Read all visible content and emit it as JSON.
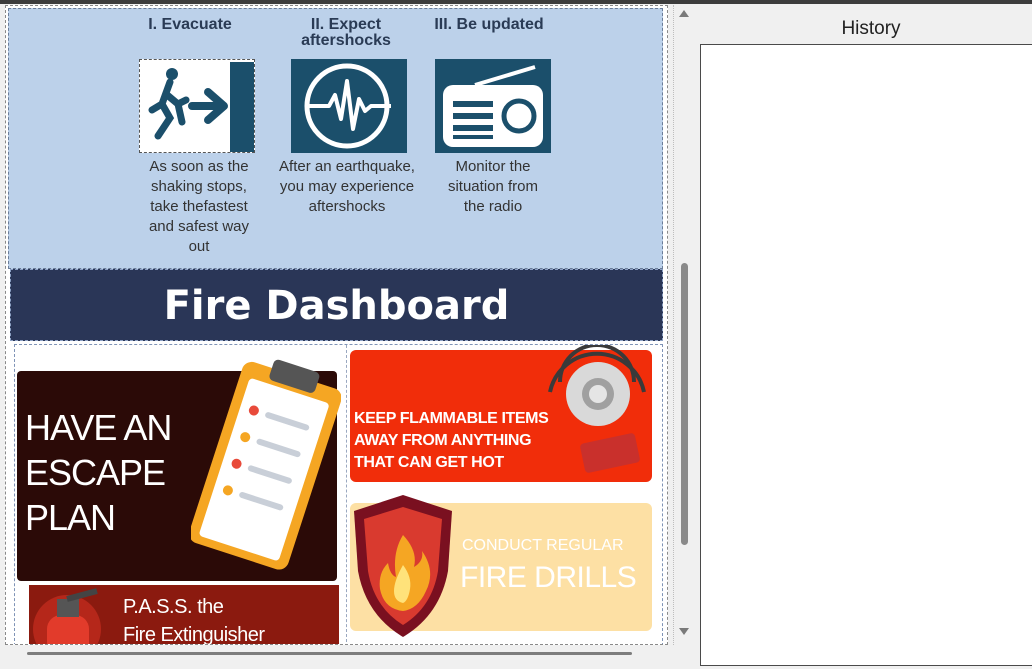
{
  "earthquake": {
    "steps": [
      {
        "title": "I. Evacuate",
        "icon": "exit-sign-icon",
        "text": [
          "As soon as the",
          "shaking stops,",
          "take thefastest",
          "and safest way",
          "out"
        ]
      },
      {
        "title_line1": "II. Expect",
        "title_line2": "aftershocks",
        "icon": "seismograph-icon",
        "text": [
          "After an earthquake,",
          "you may experience",
          "aftershocks"
        ]
      },
      {
        "title": "III. Be updated",
        "icon": "radio-icon",
        "text": [
          "Monitor the",
          "situation from",
          "the radio"
        ]
      }
    ],
    "colors": {
      "background": "#bcd1ea",
      "icon_bg": "#1b4f6b"
    }
  },
  "fire": {
    "header": "Fire Dashboard",
    "escape_plan": {
      "lines": [
        "HAVE AN",
        "ESCAPE",
        "PLAN"
      ],
      "icon": "clipboard-checklist-icon"
    },
    "pass": {
      "line1": "P.A.S.S. the",
      "line2": "Fire Extinguisher",
      "icon": "fire-extinguisher-icon"
    },
    "flammable": {
      "lines": [
        "KEEP FLAMMABLE ITEMS",
        "AWAY FROM ANYTHING",
        "THAT CAN GET HOT"
      ],
      "icon": "fire-alarm-bell-icon"
    },
    "drills": {
      "small": "CONDUCT REGULAR",
      "big": "FIRE DRILLS",
      "icon": "fire-shield-icon"
    },
    "colors": {
      "header_bg": "#2a3657",
      "escape_bg": "#2b0a07",
      "pass_bg": "#8b1a0f",
      "flam_bg": "#f12d0a",
      "drill_bg": "#fde0a4"
    }
  },
  "history": {
    "label": "History"
  }
}
